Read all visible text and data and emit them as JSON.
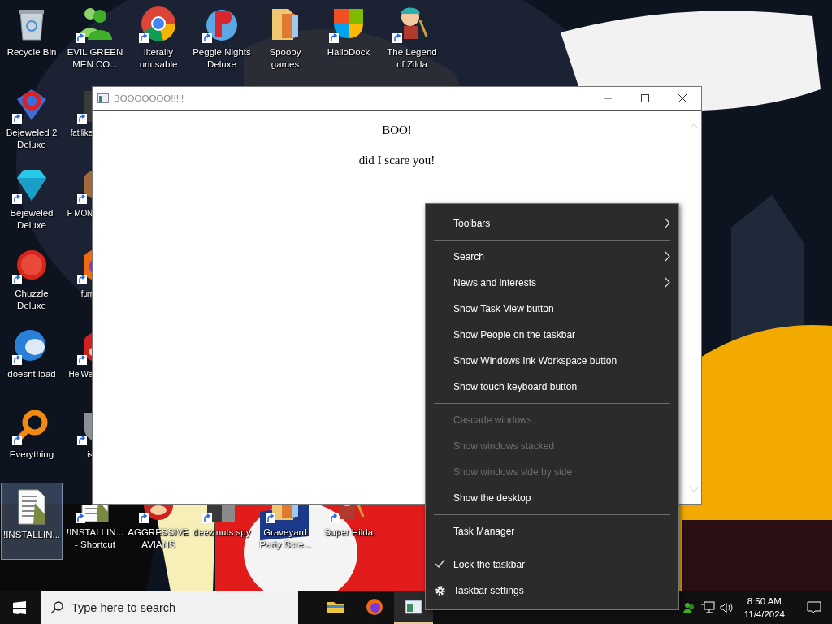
{
  "desktop_icons": {
    "top_row": [
      {
        "label": "Recycle Bin",
        "kind": "bin",
        "shortcut": false,
        "selected": false
      },
      {
        "label": "EVIL GREEN MEN CO...",
        "kind": "people",
        "shortcut": true,
        "selected": false
      },
      {
        "label": "literally unusable",
        "kind": "browser",
        "shortcut": true,
        "selected": false
      },
      {
        "label": "Peggle Nights Deluxe",
        "kind": "ball",
        "shortcut": true,
        "selected": false
      },
      {
        "label": "Spoopy games",
        "kind": "folder",
        "shortcut": false,
        "selected": false
      },
      {
        "label": "HalloDock",
        "kind": "shield",
        "shortcut": true,
        "selected": false
      },
      {
        "label": "The Legend of Zilda",
        "kind": "figure",
        "shortcut": true,
        "selected": false
      }
    ],
    "middle_rows": [
      [
        {
          "label": "Bejeweled 2 Deluxe",
          "kind": "gem2",
          "shortcut": true,
          "selected": false
        },
        {
          "label": "fat like",
          "kind": "app",
          "shortcut": true,
          "selected": false
        }
      ],
      [
        {
          "label": "Bejeweled Deluxe",
          "kind": "gem",
          "shortcut": true,
          "selected": false
        },
        {
          "label": "F MON",
          "kind": "creature",
          "shortcut": true,
          "selected": false
        }
      ],
      [
        {
          "label": "Chuzzle Deluxe",
          "kind": "furball",
          "shortcut": true,
          "selected": false
        },
        {
          "label": "furr",
          "kind": "globe",
          "shortcut": true,
          "selected": false
        }
      ],
      [
        {
          "label": "doesnt load",
          "kind": "bird",
          "shortcut": true,
          "selected": false
        },
        {
          "label": "He We",
          "kind": "redball",
          "shortcut": true,
          "selected": false
        }
      ],
      [
        {
          "label": "Everything",
          "kind": "ring",
          "shortcut": true,
          "selected": false
        },
        {
          "label": "is",
          "kind": "shield2",
          "shortcut": true,
          "selected": false
        }
      ]
    ],
    "bottom_row": [
      {
        "label": "!INSTALLIN...",
        "kind": "document",
        "shortcut": false,
        "selected": true
      },
      {
        "label": "!INSTALLIN... - Shortcut",
        "kind": "document",
        "shortcut": true,
        "selected": false
      },
      {
        "label": "AGGRESSIVE AVIANS",
        "kind": "redball",
        "shortcut": true,
        "selected": false
      },
      {
        "label": "deez nuts spy",
        "kind": "app",
        "shortcut": true,
        "selected": false
      },
      {
        "label": "Graveyard Party Scre...",
        "kind": "folder",
        "shortcut": true,
        "selected": false
      },
      {
        "label": "Super Hilda",
        "kind": "figure",
        "shortcut": true,
        "selected": false
      }
    ]
  },
  "window": {
    "title": "BOOOOOOO!!!!!",
    "heading": "BOO!",
    "message": "did I scare you!"
  },
  "context_menu": [
    {
      "kind": "item",
      "label": "Toolbars",
      "submenu": true,
      "disabled": false,
      "checked": false
    },
    {
      "kind": "separator"
    },
    {
      "kind": "item",
      "label": "Search",
      "submenu": true,
      "disabled": false,
      "checked": false
    },
    {
      "kind": "item",
      "label": "News and interests",
      "submenu": true,
      "disabled": false,
      "checked": false
    },
    {
      "kind": "item",
      "label": "Show Task View button",
      "submenu": false,
      "disabled": false,
      "checked": false
    },
    {
      "kind": "item",
      "label": "Show People on the taskbar",
      "submenu": false,
      "disabled": false,
      "checked": false
    },
    {
      "kind": "item",
      "label": "Show Windows Ink Workspace button",
      "submenu": false,
      "disabled": false,
      "checked": false
    },
    {
      "kind": "item",
      "label": "Show touch keyboard button",
      "submenu": false,
      "disabled": false,
      "checked": false
    },
    {
      "kind": "separator"
    },
    {
      "kind": "item",
      "label": "Cascade windows",
      "submenu": false,
      "disabled": true,
      "checked": false
    },
    {
      "kind": "item",
      "label": "Show windows stacked",
      "submenu": false,
      "disabled": true,
      "checked": false
    },
    {
      "kind": "item",
      "label": "Show windows side by side",
      "submenu": false,
      "disabled": true,
      "checked": false
    },
    {
      "kind": "item",
      "label": "Show the desktop",
      "submenu": false,
      "disabled": false,
      "checked": false
    },
    {
      "kind": "separator"
    },
    {
      "kind": "item",
      "label": "Task Manager",
      "submenu": false,
      "disabled": false,
      "checked": false
    },
    {
      "kind": "separator"
    },
    {
      "kind": "item",
      "label": "Lock the taskbar",
      "submenu": false,
      "disabled": false,
      "checked": true
    },
    {
      "kind": "settings",
      "label": "Taskbar settings",
      "submenu": false,
      "disabled": false,
      "checked": false
    }
  ],
  "taskbar": {
    "search": {
      "placeholder": "Type here to search"
    },
    "apps": [
      {
        "kind": "folder",
        "selected": false
      },
      {
        "kind": "browser",
        "selected": false
      },
      {
        "kind": "window",
        "selected": true
      }
    ],
    "time": "8:50 AM",
    "date": "11/4/2024"
  }
}
